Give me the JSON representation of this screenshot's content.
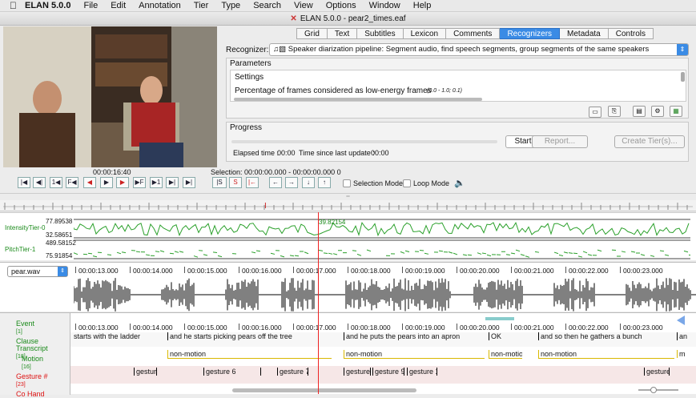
{
  "menubar": {
    "app": "ELAN 5.0.0",
    "items": [
      "File",
      "Edit",
      "Annotation",
      "Tier",
      "Type",
      "Search",
      "View",
      "Options",
      "Window",
      "Help"
    ]
  },
  "window": {
    "title": "ELAN 5.0.0 - pear2_times.eaf"
  },
  "tabs": [
    "Grid",
    "Text",
    "Subtitles",
    "Lexicon",
    "Comments",
    "Recognizers",
    "Metadata",
    "Controls"
  ],
  "selected_tab": "Recognizers",
  "recognizer": {
    "label": "Recognizer:",
    "value": "Speaker diarization pipeline: Segment audio, find speech segments, group segments of the same speakers"
  },
  "parameters": {
    "title": "Parameters",
    "settings_title": "Settings",
    "setting_text": "Percentage of frames considered as low-energy frames",
    "setting_hint": "(0.0 - 1.0; 0.1)"
  },
  "progress": {
    "title": "Progress",
    "elapsed_label": "Elapsed time :",
    "elapsed": "00:00",
    "update_label": "Time since last update :",
    "update": "00:00",
    "start": "Start",
    "report": "Report...",
    "create": "Create Tier(s)..."
  },
  "media": {
    "time": "00:00:16:40",
    "selection": "Selection: 00:00:00.000 - 00:00:00.000  0",
    "selection_mode": "Selection Mode",
    "loop_mode": "Loop Mode"
  },
  "transport_buttons": [
    "|◀",
    "◀|",
    "◀◀",
    "F◀",
    "◀",
    "▶",
    "▶|",
    "▶F",
    "▶▶",
    "|▶",
    "▶|"
  ],
  "sel_buttons": [
    "|S",
    "S",
    "|←",
    "←",
    "→",
    "↓",
    "↑"
  ],
  "plots": {
    "intensity_name": "IntensityTier-0",
    "intensity_max": "77.89538",
    "intensity_min": "32.58651",
    "pitch_name": "PitchTier-1",
    "pitch_max": "489.58152",
    "pitch_min": "75.91854",
    "cursor_value": "39.82154"
  },
  "waveform": {
    "file": "pear.wav",
    "ticks": [
      "00:00:13.000",
      "00:00:14.000",
      "00:00:15.000",
      "00:00:16.000",
      "00:00:17.000",
      "00:00:18.000",
      "00:00:19.000",
      "00:00:20.000",
      "00:00:21.000",
      "00:00:22.000",
      "00:00:23.000"
    ]
  },
  "tiers": [
    {
      "name": "Event",
      "count": "[1]",
      "color": "#1a8a1a"
    },
    {
      "name": "Clause Transcript",
      "count": "[18]",
      "color": "#1a8a1a"
    },
    {
      "name": "Motion",
      "count": "[16]",
      "color": "#1a8a1a"
    },
    {
      "name": "Gesture #",
      "count": "[23]",
      "color": "#d11"
    },
    {
      "name": "Co Hand",
      "count": "",
      "color": "#d11"
    }
  ],
  "clause_annotations": [
    "starts with the ladder",
    "and he starts picking pears off the tree",
    "and he puts the pears into an apron",
    "OK",
    "and so then he gathers a bunch",
    "an"
  ],
  "motion_annotations": [
    "non-motion",
    "non-motion",
    "non-motion",
    "non-motion",
    "m"
  ],
  "gesture_annotations": [
    "gestur",
    "gesture 6",
    "gesture 7",
    "gesture",
    "gesture 9",
    "gesture 1",
    "gesture"
  ]
}
